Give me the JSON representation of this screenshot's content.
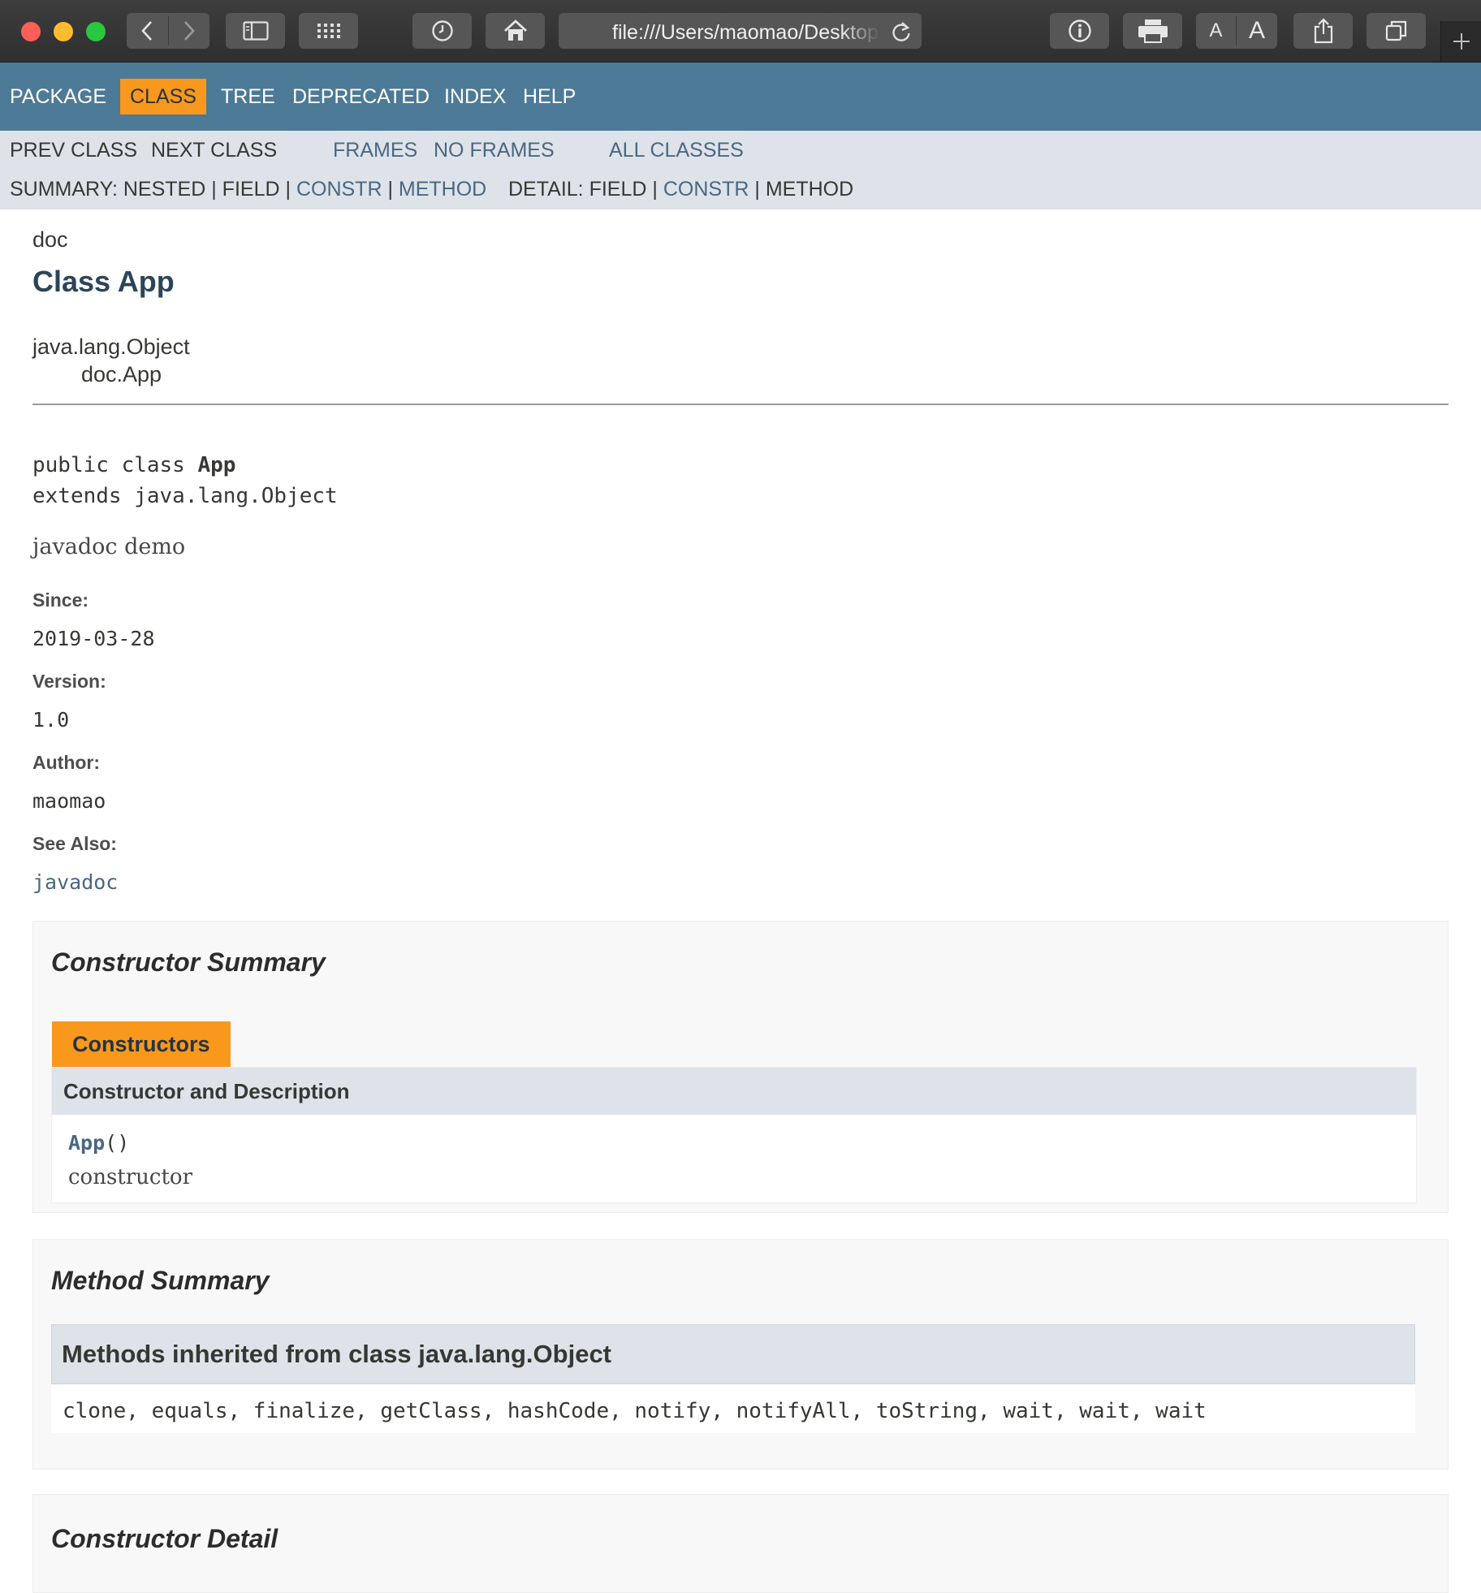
{
  "browser": {
    "url": "file:///Users/maomao/Desktop",
    "font_small_label": "A",
    "font_large_label": "A"
  },
  "colors": {
    "nav_bg": "#4d7a97",
    "nav_active": "#f8981d",
    "subnav_bg": "#dee3e9",
    "link": "#4a6782",
    "heading": "#2c4557"
  },
  "top_nav": {
    "items": [
      {
        "label": "PACKAGE"
      },
      {
        "label": "CLASS",
        "active": true
      },
      {
        "label": "TREE"
      },
      {
        "label": "DEPRECATED"
      },
      {
        "label": "INDEX"
      },
      {
        "label": "HELP"
      }
    ]
  },
  "sub_nav": {
    "prev_class": "PREV CLASS",
    "next_class": "NEXT CLASS",
    "frames": "FRAMES",
    "no_frames": "NO FRAMES",
    "all_classes": "ALL CLASSES",
    "summary_label": "SUMMARY:",
    "summary_nested": "NESTED",
    "summary_field": "FIELD",
    "summary_constr": "CONSTR",
    "summary_method": "METHOD",
    "detail_label": "DETAIL:",
    "detail_field": "FIELD",
    "detail_constr": "CONSTR",
    "detail_method": "METHOD",
    "sep": "|"
  },
  "header": {
    "package": "doc",
    "title": "Class App",
    "inheritance_root": "java.lang.Object",
    "inheritance_class": "doc.App"
  },
  "signature": {
    "line1_prefix": "public class ",
    "line1_name": "App",
    "line2": "extends java.lang.Object"
  },
  "description": "javadoc demo",
  "tags": {
    "since_label": "Since:",
    "since_value": "2019-03-28",
    "version_label": "Version:",
    "version_value": "1.0",
    "author_label": "Author:",
    "author_value": "maomao",
    "see_also_label": "See Also:",
    "see_also_value": "javadoc"
  },
  "constructor_summary": {
    "heading": "Constructor Summary",
    "tab": "Constructors",
    "column": "Constructor and Description",
    "name": "App",
    "params": "()",
    "desc": "constructor"
  },
  "method_summary": {
    "heading": "Method Summary",
    "inherited_heading": "Methods inherited from class java.lang.Object",
    "methods": "clone, equals, finalize, getClass, hashCode, notify, notifyAll, toString, wait, wait, wait"
  },
  "constructor_detail": {
    "heading": "Constructor Detail"
  }
}
